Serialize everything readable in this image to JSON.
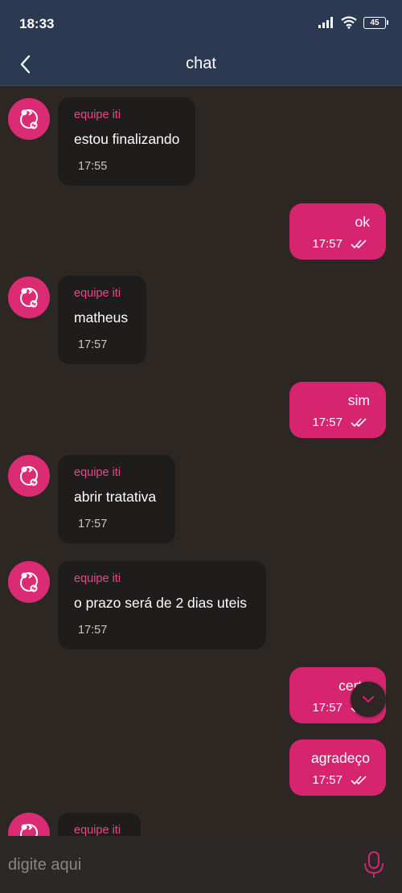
{
  "status_bar": {
    "time": "18:33",
    "battery": "45"
  },
  "app_bar": {
    "title": "chat",
    "back_icon": "chevron-left-icon"
  },
  "colors": {
    "accent": "#d6246f",
    "header": "#2b3a52",
    "background": "#2d2723",
    "incoming_bubble": "#1f1d1c"
  },
  "messages": [
    {
      "direction": "in",
      "sender": "equipe iti",
      "text": "estou finalizando",
      "time": "17:55"
    },
    {
      "direction": "out",
      "text": "ok",
      "time": "17:57",
      "status": "double-check-icon"
    },
    {
      "direction": "in",
      "sender": "equipe iti",
      "text": "matheus",
      "time": "17:57"
    },
    {
      "direction": "out",
      "text": "sim",
      "time": "17:57",
      "status": "double-check-icon"
    },
    {
      "direction": "in",
      "sender": "equipe iti",
      "text": "abrir tratativa",
      "time": "17:57"
    },
    {
      "direction": "in",
      "sender": "equipe iti",
      "text": "o prazo será de 2 dias uteis",
      "time": "17:57"
    },
    {
      "direction": "out",
      "text": "certo",
      "time": "17:57",
      "status": "double-check-icon"
    },
    {
      "direction": "out",
      "text": "agradeço",
      "time": "17:57",
      "status": "double-check-icon"
    },
    {
      "direction": "in",
      "sender": "equipe iti",
      "text": "",
      "time": ""
    }
  ],
  "composer": {
    "placeholder": "digite aqui",
    "value": "",
    "mic_icon": "microphone-icon"
  },
  "scroll_button_icon": "chevron-down-icon"
}
